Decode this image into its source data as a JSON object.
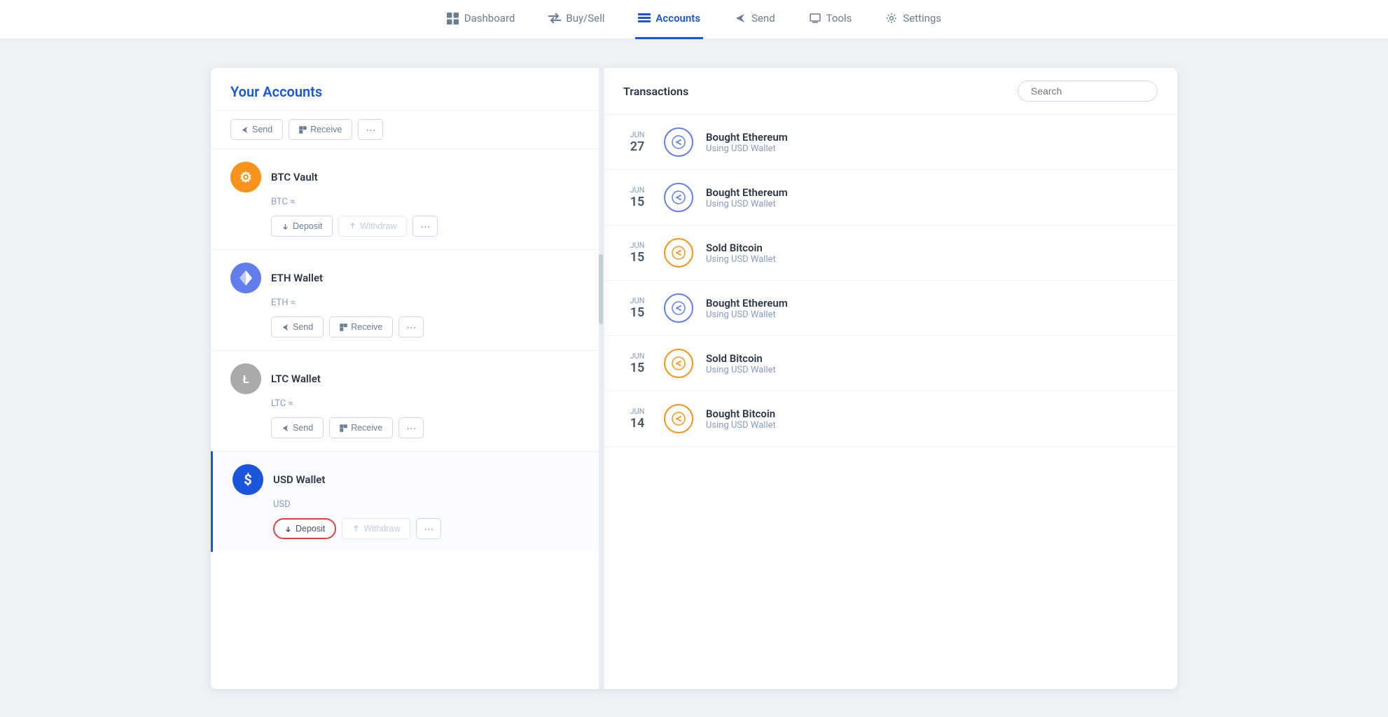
{
  "nav": {
    "items": [
      {
        "id": "dashboard",
        "label": "Dashboard",
        "icon": "⊞",
        "active": false
      },
      {
        "id": "buysell",
        "label": "Buy/Sell",
        "icon": "⇄",
        "active": false
      },
      {
        "id": "accounts",
        "label": "Accounts",
        "icon": "💼",
        "active": true
      },
      {
        "id": "send",
        "label": "Send",
        "icon": "➤",
        "active": false
      },
      {
        "id": "tools",
        "label": "Tools",
        "icon": "🗂",
        "active": false
      },
      {
        "id": "settings",
        "label": "Settings",
        "icon": "⚙",
        "active": false
      }
    ]
  },
  "sidebar": {
    "title": "Your Accounts",
    "accounts": [
      {
        "id": "btc-vault",
        "name": "BTC Vault",
        "balance": "BTC ≈",
        "type": "btc",
        "iconSymbol": "⚙",
        "actions": [
          "Deposit",
          "Withdraw"
        ],
        "selected": false
      },
      {
        "id": "eth-wallet",
        "name": "ETH Wallet",
        "balance": "ETH ≈",
        "type": "eth",
        "iconSymbol": "◆",
        "actions": [
          "Send",
          "Receive"
        ],
        "selected": false
      },
      {
        "id": "ltc-wallet",
        "name": "LTC Wallet",
        "balance": "LTC ≈",
        "type": "ltc",
        "iconSymbol": "Ł",
        "actions": [
          "Send",
          "Receive"
        ],
        "selected": false
      },
      {
        "id": "usd-wallet",
        "name": "USD Wallet",
        "balance": "USD",
        "type": "usd",
        "iconSymbol": "$",
        "actions": [
          "Deposit",
          "Withdraw"
        ],
        "selected": true
      }
    ]
  },
  "transactions": {
    "title": "Transactions",
    "search_placeholder": "Search",
    "items": [
      {
        "month": "JUN",
        "day": "27",
        "type": "blue",
        "name": "Bought Ethereum",
        "sub": "Using USD Wallet"
      },
      {
        "month": "JUN",
        "day": "15",
        "type": "blue",
        "name": "Bought Ethereum",
        "sub": "Using USD Wallet"
      },
      {
        "month": "JUN",
        "day": "15",
        "type": "yellow",
        "name": "Sold Bitcoin",
        "sub": "Using USD Wallet"
      },
      {
        "month": "JUN",
        "day": "15",
        "type": "blue",
        "name": "Bought Ethereum",
        "sub": "Using USD Wallet"
      },
      {
        "month": "JUN",
        "day": "15",
        "type": "yellow",
        "name": "Sold Bitcoin",
        "sub": "Using USD Wallet"
      },
      {
        "month": "JUN",
        "day": "14",
        "type": "yellow",
        "name": "Bought Bitcoin",
        "sub": "Using USD Wallet"
      }
    ]
  }
}
